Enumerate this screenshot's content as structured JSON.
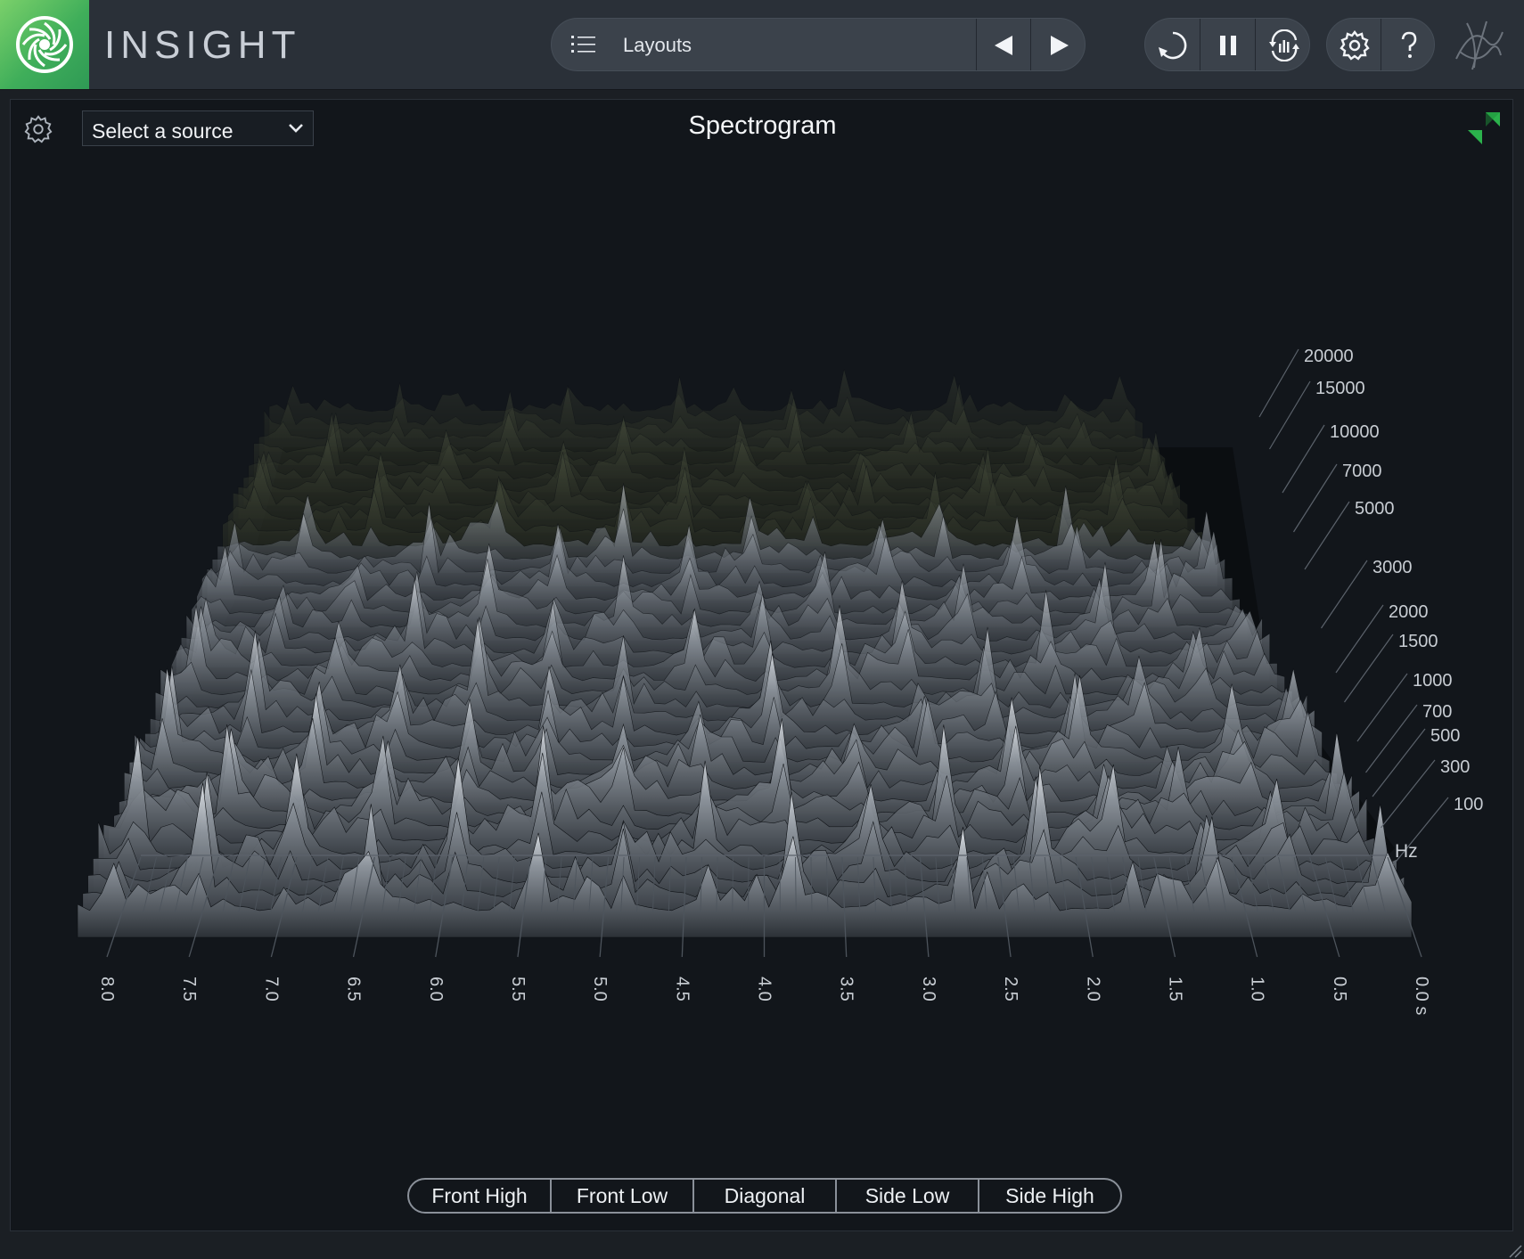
{
  "app": {
    "title": "INSIGHT"
  },
  "toolbar": {
    "layouts_label": "Layouts"
  },
  "icons": {
    "logo": "insight-logo-icon",
    "list": "list-icon",
    "prev": "triangle-left-icon",
    "next": "triangle-right-icon",
    "loop": "loop-icon",
    "pause": "pause-icon",
    "reset": "reset-meter-icon",
    "settings": "gear-icon",
    "help": "question-icon",
    "brand": "izotope-logo-icon",
    "collapse": "collapse-arrows-icon"
  },
  "panel": {
    "title": "Spectrogram",
    "source_select": {
      "selected": "Select a source"
    }
  },
  "axes": {
    "freq_labels": [
      "20000",
      "15000",
      "10000",
      "7000",
      "5000",
      "3000",
      "2000",
      "1500",
      "1000",
      "700",
      "500",
      "300",
      "100"
    ],
    "freq_unit": "Hz",
    "time_labels": [
      "8.0",
      "7.5",
      "7.0",
      "6.5",
      "6.0",
      "5.5",
      "5.0",
      "4.5",
      "4.0",
      "3.5",
      "3.0",
      "2.5",
      "2.0",
      "1.5",
      "1.0",
      "0.5",
      "0.0 s"
    ]
  },
  "view_buttons": [
    "Front High",
    "Front Low",
    "Diagonal",
    "Side Low",
    "Side High"
  ],
  "colors": {
    "accent_green": "#3fae5a",
    "panel_bg": "#12161b",
    "toolbar_bg": "#2a3038"
  }
}
